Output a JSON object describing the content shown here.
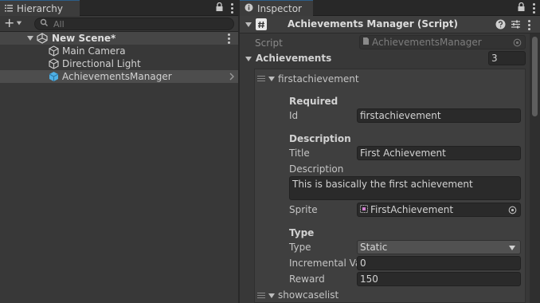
{
  "hierarchy": {
    "tab_label": "Hierarchy",
    "search_placeholder": "All",
    "scene": {
      "name": "New Scene*"
    },
    "objects": [
      {
        "name": "Main Camera"
      },
      {
        "name": "Directional Light"
      },
      {
        "name": "AchievementsManager",
        "selected": true
      }
    ]
  },
  "inspector": {
    "tab_label": "Inspector",
    "component_title": "Achievements Manager (Script)",
    "script_label": "Script",
    "script_value": "AchievementsManager",
    "list_label": "Achievements",
    "list_count": "3",
    "element": {
      "name": "firstachievement",
      "required_header": "Required",
      "id_label": "Id",
      "id_value": "firstachievement",
      "description_header": "Description",
      "title_label": "Title",
      "title_value": "First Achievement",
      "description_label": "Description",
      "description_value": "This is basically the first achievement",
      "sprite_label": "Sprite",
      "sprite_value": "FirstAchievement",
      "type_header": "Type",
      "type_label": "Type",
      "type_value": "Static",
      "incremental_label": "Incremental Va",
      "incremental_value": "0",
      "reward_label": "Reward",
      "reward_value": "150"
    },
    "next_element": {
      "name": "showcaselist"
    }
  },
  "colors": {
    "panel_bg": "#383838",
    "selection_bg": "#4d4d4d",
    "field_bg": "#2a2a2a",
    "icon_blue": "#4fb0e6"
  }
}
